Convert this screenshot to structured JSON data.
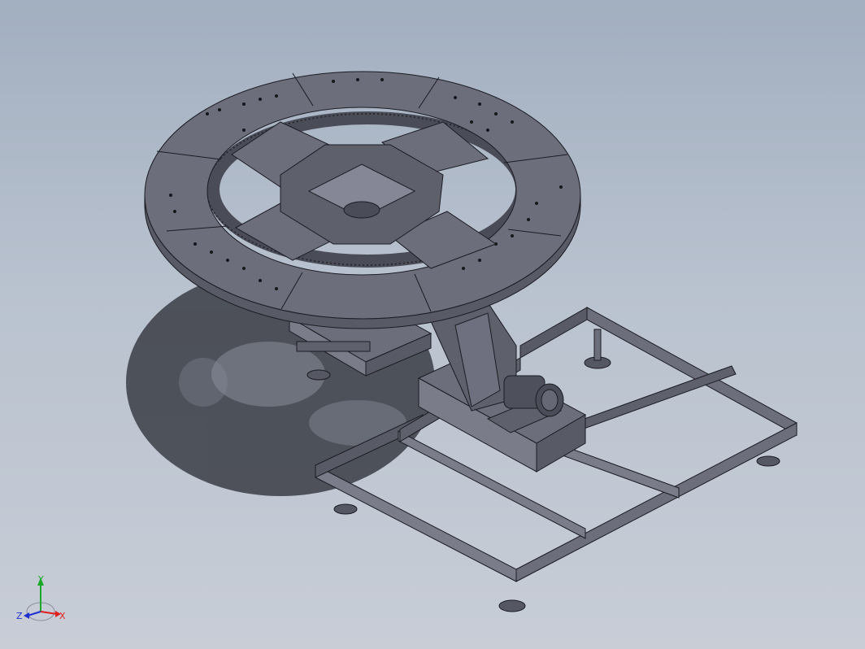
{
  "viewport": {
    "background_top": "#a2afc0",
    "background_bottom": "#c8cdd6"
  },
  "model": {
    "part_color": "#6c6e7c",
    "part_dark": "#4e505c",
    "part_light": "#858796",
    "edge_color": "#1c1c22",
    "shadow_color": "#3a3d45"
  },
  "triad": {
    "x_label": "X",
    "y_label": "Y",
    "z_label": "Z",
    "x_color": "#e02020",
    "y_color": "#1aa82a",
    "z_color": "#2030d0"
  }
}
